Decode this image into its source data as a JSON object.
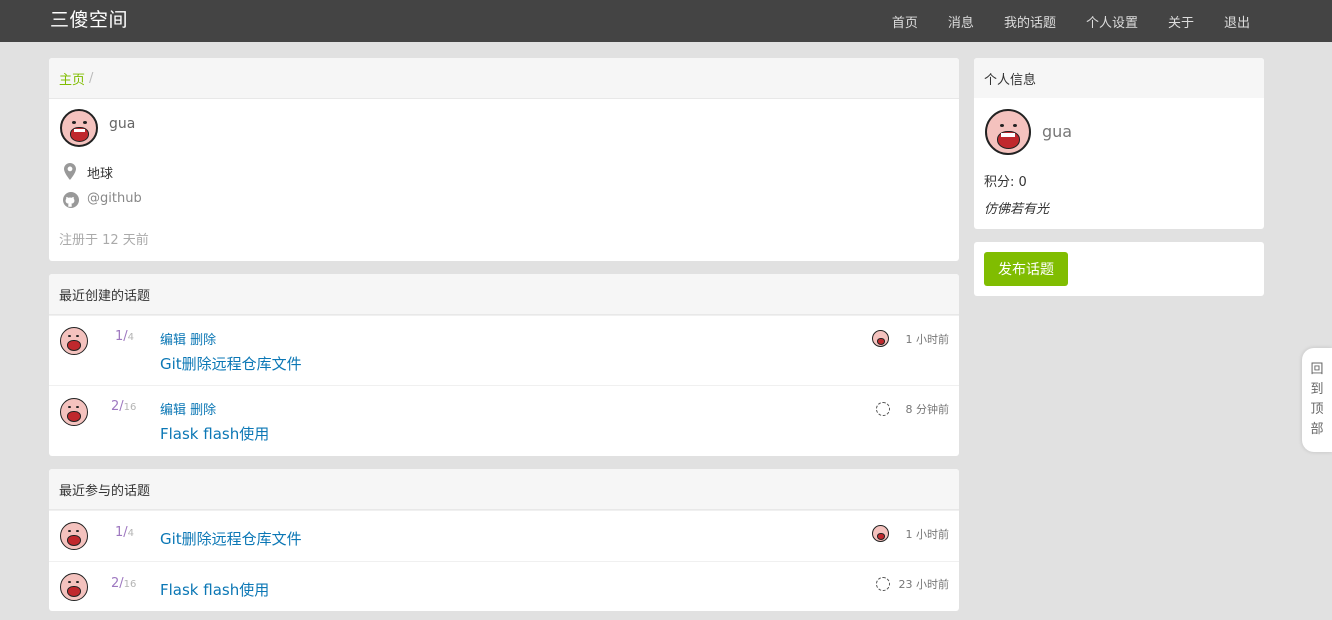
{
  "navbar": {
    "brand": "三傻空间",
    "links": [
      "首页",
      "消息",
      "我的话题",
      "个人设置",
      "关于",
      "退出"
    ]
  },
  "profile": {
    "breadcrumb_home": "主页",
    "breadcrumb_sep": "/",
    "username": "gua",
    "location": "地球",
    "github": "@github",
    "registered": "注册于 12 天前"
  },
  "recent_created": {
    "title": "最近创建的话题",
    "topics": [
      {
        "replies": "1",
        "views": "4",
        "edit": "编辑",
        "delete": "删除",
        "title": "Git删除远程仓库文件",
        "time": "1 小时前"
      },
      {
        "replies": "2",
        "views": "16",
        "edit": "编辑",
        "delete": "删除",
        "title": "Flask flash使用",
        "time": "8 分钟前"
      }
    ]
  },
  "recent_participated": {
    "title": "最近参与的话题",
    "topics": [
      {
        "replies": "1",
        "views": "4",
        "title": "Git删除远程仓库文件",
        "time": "1 小时前"
      },
      {
        "replies": "2",
        "views": "16",
        "title": "Flask flash使用",
        "time": "23 小时前"
      }
    ]
  },
  "sidebar": {
    "info_title": "个人信息",
    "username": "gua",
    "score_label": "积分: 0",
    "signature": "仿佛若有光",
    "publish_button": "发布话题"
  },
  "back_to_top": [
    "回",
    "到",
    "顶",
    "部"
  ],
  "colors": {
    "navbar_bg": "#444444",
    "accent_green": "#80bd01",
    "link_blue": "#0b77b5",
    "page_bg": "#e1e1e1"
  }
}
